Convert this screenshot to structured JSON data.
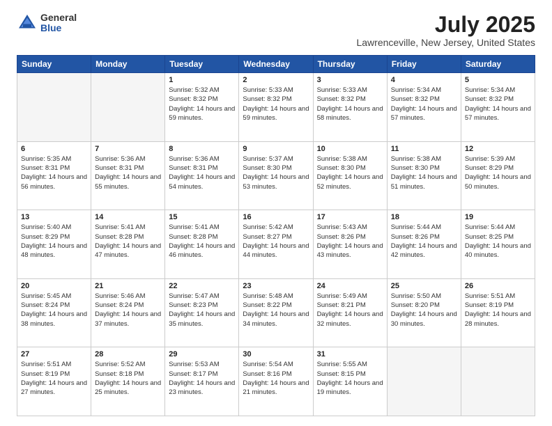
{
  "logo": {
    "general": "General",
    "blue": "Blue"
  },
  "title": "July 2025",
  "location": "Lawrenceville, New Jersey, United States",
  "headers": [
    "Sunday",
    "Monday",
    "Tuesday",
    "Wednesday",
    "Thursday",
    "Friday",
    "Saturday"
  ],
  "weeks": [
    [
      {
        "day": "",
        "sunrise": "",
        "sunset": "",
        "daylight": "",
        "empty": true
      },
      {
        "day": "",
        "sunrise": "",
        "sunset": "",
        "daylight": "",
        "empty": true
      },
      {
        "day": "1",
        "sunrise": "Sunrise: 5:32 AM",
        "sunset": "Sunset: 8:32 PM",
        "daylight": "Daylight: 14 hours and 59 minutes.",
        "empty": false
      },
      {
        "day": "2",
        "sunrise": "Sunrise: 5:33 AM",
        "sunset": "Sunset: 8:32 PM",
        "daylight": "Daylight: 14 hours and 59 minutes.",
        "empty": false
      },
      {
        "day": "3",
        "sunrise": "Sunrise: 5:33 AM",
        "sunset": "Sunset: 8:32 PM",
        "daylight": "Daylight: 14 hours and 58 minutes.",
        "empty": false
      },
      {
        "day": "4",
        "sunrise": "Sunrise: 5:34 AM",
        "sunset": "Sunset: 8:32 PM",
        "daylight": "Daylight: 14 hours and 57 minutes.",
        "empty": false
      },
      {
        "day": "5",
        "sunrise": "Sunrise: 5:34 AM",
        "sunset": "Sunset: 8:32 PM",
        "daylight": "Daylight: 14 hours and 57 minutes.",
        "empty": false
      }
    ],
    [
      {
        "day": "6",
        "sunrise": "Sunrise: 5:35 AM",
        "sunset": "Sunset: 8:31 PM",
        "daylight": "Daylight: 14 hours and 56 minutes.",
        "empty": false
      },
      {
        "day": "7",
        "sunrise": "Sunrise: 5:36 AM",
        "sunset": "Sunset: 8:31 PM",
        "daylight": "Daylight: 14 hours and 55 minutes.",
        "empty": false
      },
      {
        "day": "8",
        "sunrise": "Sunrise: 5:36 AM",
        "sunset": "Sunset: 8:31 PM",
        "daylight": "Daylight: 14 hours and 54 minutes.",
        "empty": false
      },
      {
        "day": "9",
        "sunrise": "Sunrise: 5:37 AM",
        "sunset": "Sunset: 8:30 PM",
        "daylight": "Daylight: 14 hours and 53 minutes.",
        "empty": false
      },
      {
        "day": "10",
        "sunrise": "Sunrise: 5:38 AM",
        "sunset": "Sunset: 8:30 PM",
        "daylight": "Daylight: 14 hours and 52 minutes.",
        "empty": false
      },
      {
        "day": "11",
        "sunrise": "Sunrise: 5:38 AM",
        "sunset": "Sunset: 8:30 PM",
        "daylight": "Daylight: 14 hours and 51 minutes.",
        "empty": false
      },
      {
        "day": "12",
        "sunrise": "Sunrise: 5:39 AM",
        "sunset": "Sunset: 8:29 PM",
        "daylight": "Daylight: 14 hours and 50 minutes.",
        "empty": false
      }
    ],
    [
      {
        "day": "13",
        "sunrise": "Sunrise: 5:40 AM",
        "sunset": "Sunset: 8:29 PM",
        "daylight": "Daylight: 14 hours and 48 minutes.",
        "empty": false
      },
      {
        "day": "14",
        "sunrise": "Sunrise: 5:41 AM",
        "sunset": "Sunset: 8:28 PM",
        "daylight": "Daylight: 14 hours and 47 minutes.",
        "empty": false
      },
      {
        "day": "15",
        "sunrise": "Sunrise: 5:41 AM",
        "sunset": "Sunset: 8:28 PM",
        "daylight": "Daylight: 14 hours and 46 minutes.",
        "empty": false
      },
      {
        "day": "16",
        "sunrise": "Sunrise: 5:42 AM",
        "sunset": "Sunset: 8:27 PM",
        "daylight": "Daylight: 14 hours and 44 minutes.",
        "empty": false
      },
      {
        "day": "17",
        "sunrise": "Sunrise: 5:43 AM",
        "sunset": "Sunset: 8:26 PM",
        "daylight": "Daylight: 14 hours and 43 minutes.",
        "empty": false
      },
      {
        "day": "18",
        "sunrise": "Sunrise: 5:44 AM",
        "sunset": "Sunset: 8:26 PM",
        "daylight": "Daylight: 14 hours and 42 minutes.",
        "empty": false
      },
      {
        "day": "19",
        "sunrise": "Sunrise: 5:44 AM",
        "sunset": "Sunset: 8:25 PM",
        "daylight": "Daylight: 14 hours and 40 minutes.",
        "empty": false
      }
    ],
    [
      {
        "day": "20",
        "sunrise": "Sunrise: 5:45 AM",
        "sunset": "Sunset: 8:24 PM",
        "daylight": "Daylight: 14 hours and 38 minutes.",
        "empty": false
      },
      {
        "day": "21",
        "sunrise": "Sunrise: 5:46 AM",
        "sunset": "Sunset: 8:24 PM",
        "daylight": "Daylight: 14 hours and 37 minutes.",
        "empty": false
      },
      {
        "day": "22",
        "sunrise": "Sunrise: 5:47 AM",
        "sunset": "Sunset: 8:23 PM",
        "daylight": "Daylight: 14 hours and 35 minutes.",
        "empty": false
      },
      {
        "day": "23",
        "sunrise": "Sunrise: 5:48 AM",
        "sunset": "Sunset: 8:22 PM",
        "daylight": "Daylight: 14 hours and 34 minutes.",
        "empty": false
      },
      {
        "day": "24",
        "sunrise": "Sunrise: 5:49 AM",
        "sunset": "Sunset: 8:21 PM",
        "daylight": "Daylight: 14 hours and 32 minutes.",
        "empty": false
      },
      {
        "day": "25",
        "sunrise": "Sunrise: 5:50 AM",
        "sunset": "Sunset: 8:20 PM",
        "daylight": "Daylight: 14 hours and 30 minutes.",
        "empty": false
      },
      {
        "day": "26",
        "sunrise": "Sunrise: 5:51 AM",
        "sunset": "Sunset: 8:19 PM",
        "daylight": "Daylight: 14 hours and 28 minutes.",
        "empty": false
      }
    ],
    [
      {
        "day": "27",
        "sunrise": "Sunrise: 5:51 AM",
        "sunset": "Sunset: 8:19 PM",
        "daylight": "Daylight: 14 hours and 27 minutes.",
        "empty": false
      },
      {
        "day": "28",
        "sunrise": "Sunrise: 5:52 AM",
        "sunset": "Sunset: 8:18 PM",
        "daylight": "Daylight: 14 hours and 25 minutes.",
        "empty": false
      },
      {
        "day": "29",
        "sunrise": "Sunrise: 5:53 AM",
        "sunset": "Sunset: 8:17 PM",
        "daylight": "Daylight: 14 hours and 23 minutes.",
        "empty": false
      },
      {
        "day": "30",
        "sunrise": "Sunrise: 5:54 AM",
        "sunset": "Sunset: 8:16 PM",
        "daylight": "Daylight: 14 hours and 21 minutes.",
        "empty": false
      },
      {
        "day": "31",
        "sunrise": "Sunrise: 5:55 AM",
        "sunset": "Sunset: 8:15 PM",
        "daylight": "Daylight: 14 hours and 19 minutes.",
        "empty": false
      },
      {
        "day": "",
        "sunrise": "",
        "sunset": "",
        "daylight": "",
        "empty": true
      },
      {
        "day": "",
        "sunrise": "",
        "sunset": "",
        "daylight": "",
        "empty": true
      }
    ]
  ]
}
